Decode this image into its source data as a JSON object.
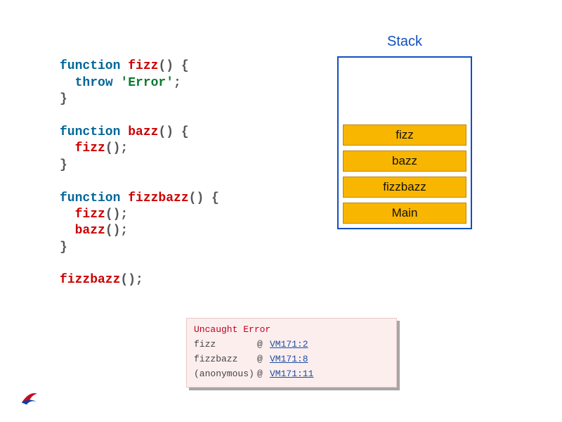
{
  "code": {
    "l1_kw": "function ",
    "l1_fn": "fizz",
    "l1_rest": "() {",
    "l2_ind": "  ",
    "l2_kw": "throw ",
    "l2_str": "'Error'",
    "l2_semi": ";",
    "l3": "}",
    "l4": "",
    "l5_kw": "function ",
    "l5_fn": "bazz",
    "l5_rest": "() {",
    "l6_ind": "  ",
    "l6_fn": "fizz",
    "l6_rest": "();",
    "l7": "}",
    "l8": "",
    "l9_kw": "function ",
    "l9_fn": "fizzbazz",
    "l9_rest": "() {",
    "l10_ind": "  ",
    "l10_fn": "fizz",
    "l10_rest": "();",
    "l11_ind": "  ",
    "l11_fn": "bazz",
    "l11_rest": "();",
    "l12": "}",
    "l13": "",
    "l14_fn": "fizzbazz",
    "l14_rest": "();"
  },
  "stack": {
    "label": "Stack",
    "frames": [
      "fizz",
      "bazz",
      "fizzbazz",
      "Main"
    ]
  },
  "console": {
    "title": "Uncaught Error",
    "rows": [
      {
        "name": "fizz",
        "loc": "VM171:2"
      },
      {
        "name": "fizzbazz",
        "loc": "VM171:8"
      },
      {
        "name": "(anonymous)",
        "loc": "VM171:11"
      }
    ],
    "at": "@"
  }
}
